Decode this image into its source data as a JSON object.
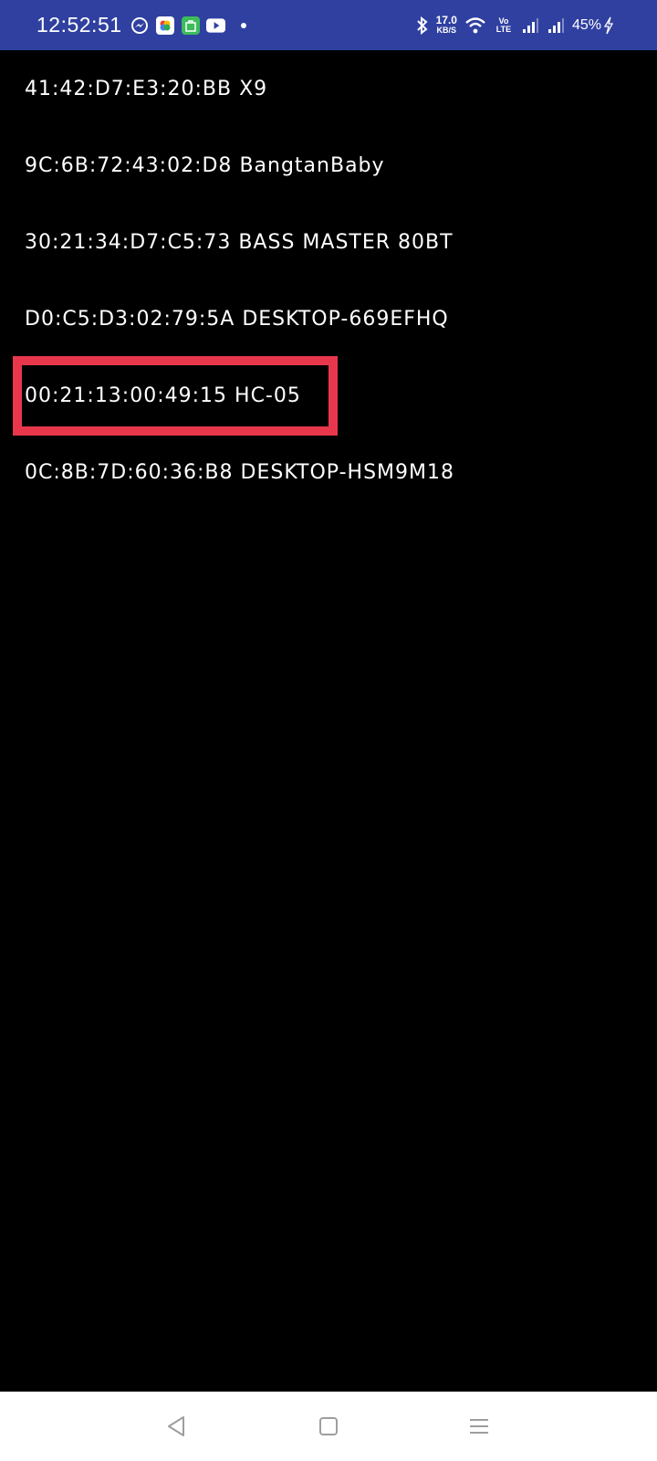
{
  "status_bar": {
    "time": "12:52:51",
    "notification_icons": [
      "messenger-icon",
      "photos-icon",
      "app-store-icon",
      "youtube-icon",
      "more-dot-icon"
    ],
    "network_speed_value": "17.0",
    "network_speed_unit": "KB/S",
    "volte_label": "Vo LTE",
    "battery_percent": "45%",
    "colors": {
      "background": "#3040A0",
      "text": "#FFFFFF"
    }
  },
  "devices": [
    {
      "address": "41:42:D7:E3:20:BB",
      "name": "X9"
    },
    {
      "address": "9C:6B:72:43:02:D8",
      "name": "BangtanBaby"
    },
    {
      "address": "30:21:34:D7:C5:73",
      "name": "BASS MASTER 80BT"
    },
    {
      "address": "D0:C5:D3:02:79:5A",
      "name": "DESKTOP-669EFHQ"
    },
    {
      "address": "00:21:13:00:49:15",
      "name": "HC-05"
    },
    {
      "address": "0C:8B:7D:60:36:B8",
      "name": "DESKTOP-HSM9M18"
    }
  ],
  "highlighted_device_index": 4,
  "highlight_color": "#E8374C",
  "nav_bar": {
    "buttons": [
      "back-icon",
      "home-icon",
      "menu-icon"
    ]
  }
}
